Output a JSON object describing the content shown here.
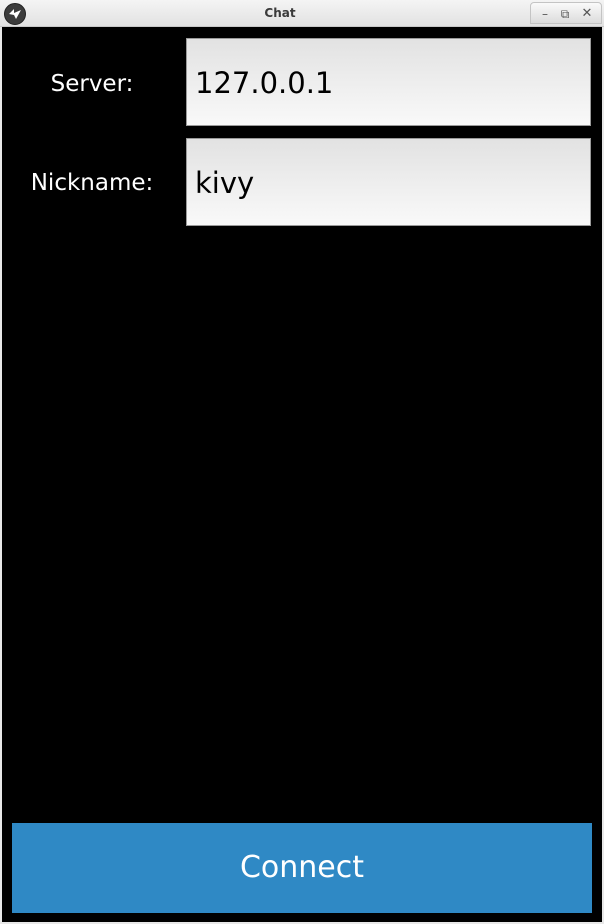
{
  "window": {
    "title": "Chat",
    "icons": {
      "app": "kivy-logo-icon",
      "minimize": "minimize-icon",
      "maximize": "restore-icon",
      "close": "close-icon"
    },
    "buttons": {
      "minimize": "–",
      "maximize": "⧉",
      "close": "✕"
    }
  },
  "form": {
    "server_label": "Server:",
    "server_value": "127.0.0.1",
    "nickname_label": "Nickname:",
    "nickname_value": "kivy",
    "connect_label": "Connect"
  },
  "colors": {
    "background": "#000000",
    "button": "#2f89c5",
    "field": "#f0f0f0"
  }
}
